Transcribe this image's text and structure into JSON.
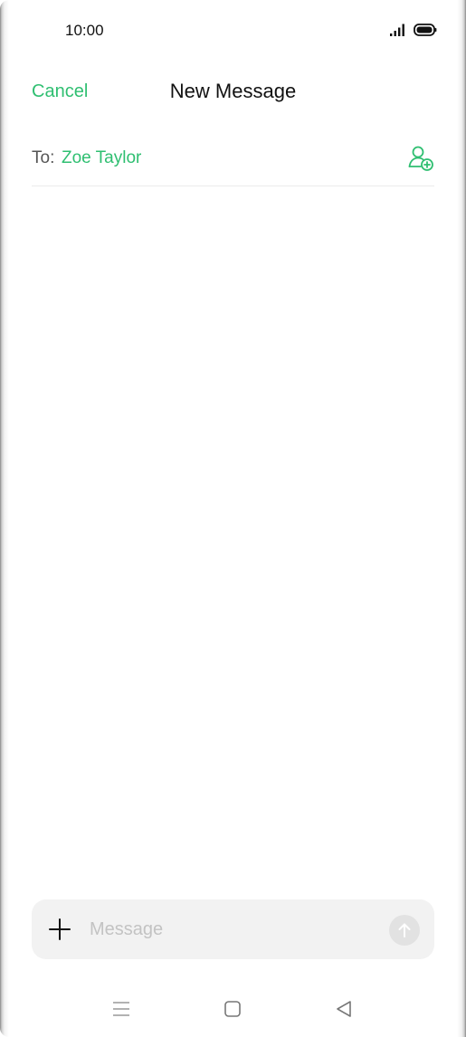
{
  "status_bar": {
    "time": "10:00",
    "signal_icon": "signal-icon",
    "battery_icon": "battery-icon"
  },
  "header": {
    "cancel_label": "Cancel",
    "title": "New Message"
  },
  "recipient": {
    "to_label": "To:",
    "name": "Zoe Taylor",
    "add_icon": "add-contact-icon"
  },
  "compose": {
    "attach_icon": "plus-icon",
    "placeholder": "Message",
    "value": "",
    "send_icon": "send-arrow-icon"
  },
  "nav_bar": {
    "menu_icon": "menu-icon",
    "home_icon": "home-icon",
    "back_icon": "back-icon"
  },
  "colors": {
    "accent": "#2fbf71",
    "text": "#111111",
    "placeholder": "#c3c3c3",
    "compose_bg": "#f2f2f2"
  }
}
